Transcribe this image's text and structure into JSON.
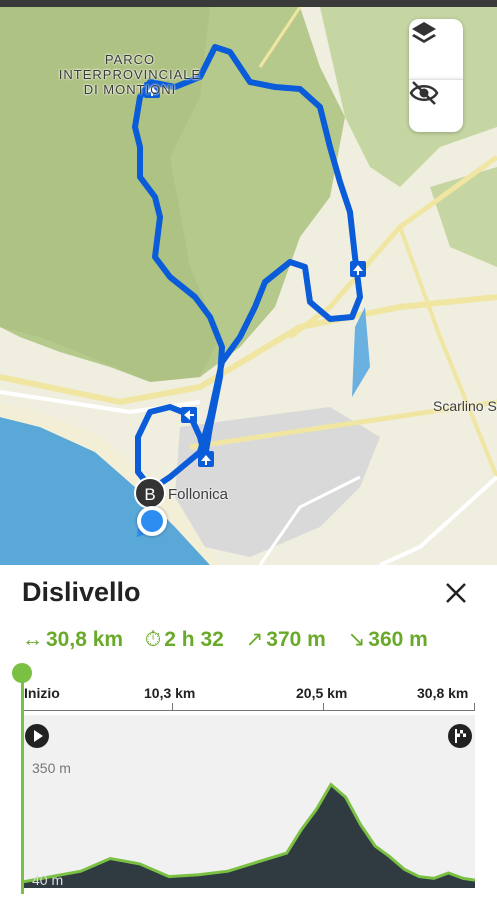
{
  "map": {
    "park_label_lines": [
      "PARCO",
      "INTERPROVINCIALE",
      "DI MONTIONI"
    ],
    "town_label": "Follonica",
    "road_label": "Scarlino S",
    "marker_b": "B",
    "route_color": "#0a5cd8",
    "controls": {
      "layers_icon": "layers-icon",
      "hide_icon": "eye-off-icon"
    }
  },
  "panel": {
    "title": "Dislivello",
    "close_icon": "close-icon",
    "stats": {
      "distance": "30,8 km",
      "duration": "2 h 32",
      "ascent": "370 m",
      "descent": "360 m"
    },
    "distance_axis": [
      "Inizio",
      "10,3 km",
      "20,5 km",
      "30,8 km"
    ],
    "elevation_labels": {
      "top": "350 m",
      "bottom": "40 m"
    },
    "accent_color": "#7ac143"
  },
  "chart_data": {
    "type": "area",
    "xlabel": "",
    "ylabel": "",
    "x_ticks": [
      "Inizio",
      "10,3 km",
      "20,5 km",
      "30,8 km"
    ],
    "x_km": [
      0,
      2,
      4,
      6,
      8,
      10,
      12,
      14,
      16,
      18,
      19,
      20,
      21,
      22,
      23,
      24,
      25,
      26,
      27,
      28,
      29,
      30,
      30.8
    ],
    "elevation_m": [
      40,
      55,
      70,
      105,
      90,
      55,
      60,
      70,
      95,
      120,
      185,
      240,
      310,
      275,
      200,
      140,
      110,
      75,
      55,
      50,
      65,
      50,
      45
    ],
    "ylim": [
      40,
      350
    ]
  }
}
